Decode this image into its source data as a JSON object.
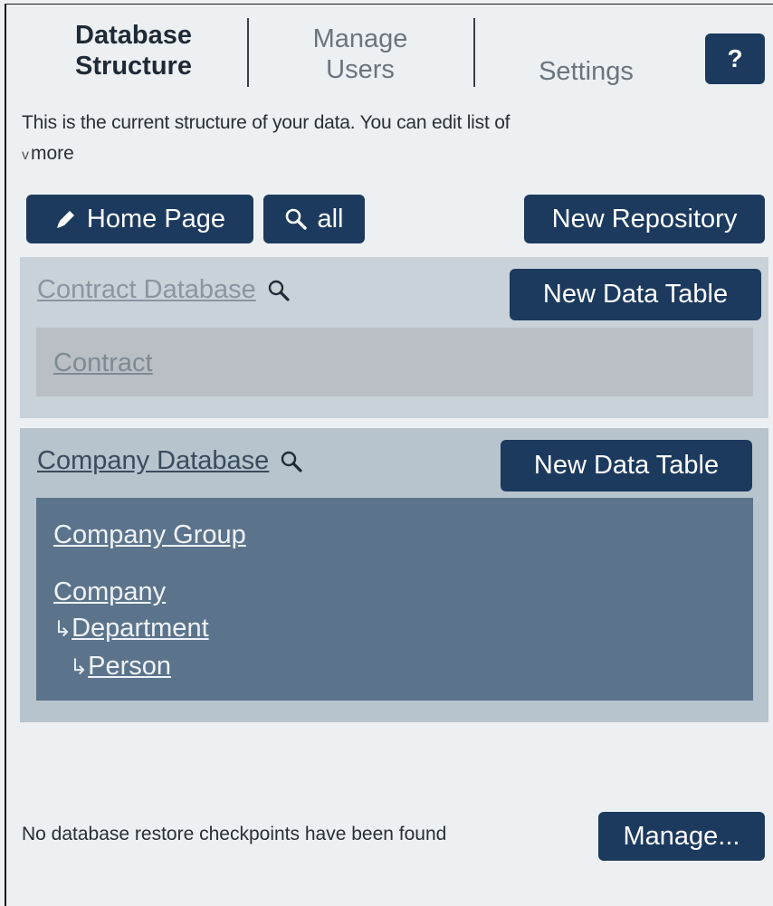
{
  "tabs": [
    {
      "line1": "Database",
      "line2": "Structure"
    },
    {
      "line1": "Manage",
      "line2": "Users"
    },
    {
      "line1": "Settings"
    }
  ],
  "help_label": "?",
  "intro_text": "This is the current structure of your data. You can edit list of",
  "more_chevron": "v",
  "more_label": "more",
  "toolbar": {
    "home_page_label": "Home Page",
    "search_all_label": "all",
    "new_repository_label": "New Repository"
  },
  "databases": [
    {
      "name": "Contract Database",
      "new_table_label": "New Data Table",
      "tables": [
        {
          "label": "Contract",
          "level": 0
        }
      ]
    },
    {
      "name": "Company Database",
      "new_table_label": "New Data Table",
      "tables": [
        {
          "label": "Company Group",
          "level": 0
        },
        {
          "label": "Company",
          "level": 0
        },
        {
          "label": "Department",
          "level": 1
        },
        {
          "label": "Person",
          "level": 2
        }
      ]
    }
  ],
  "tree_arrow": "↳",
  "footer": {
    "status_text": "No database restore checkpoints have been found",
    "manage_label": "Manage..."
  },
  "colors": {
    "button_bg": "#1c3a5e",
    "background": "#edf0f3",
    "active_panel": "#5c748b"
  },
  "icons": [
    "pencil-icon",
    "search-icon"
  ]
}
